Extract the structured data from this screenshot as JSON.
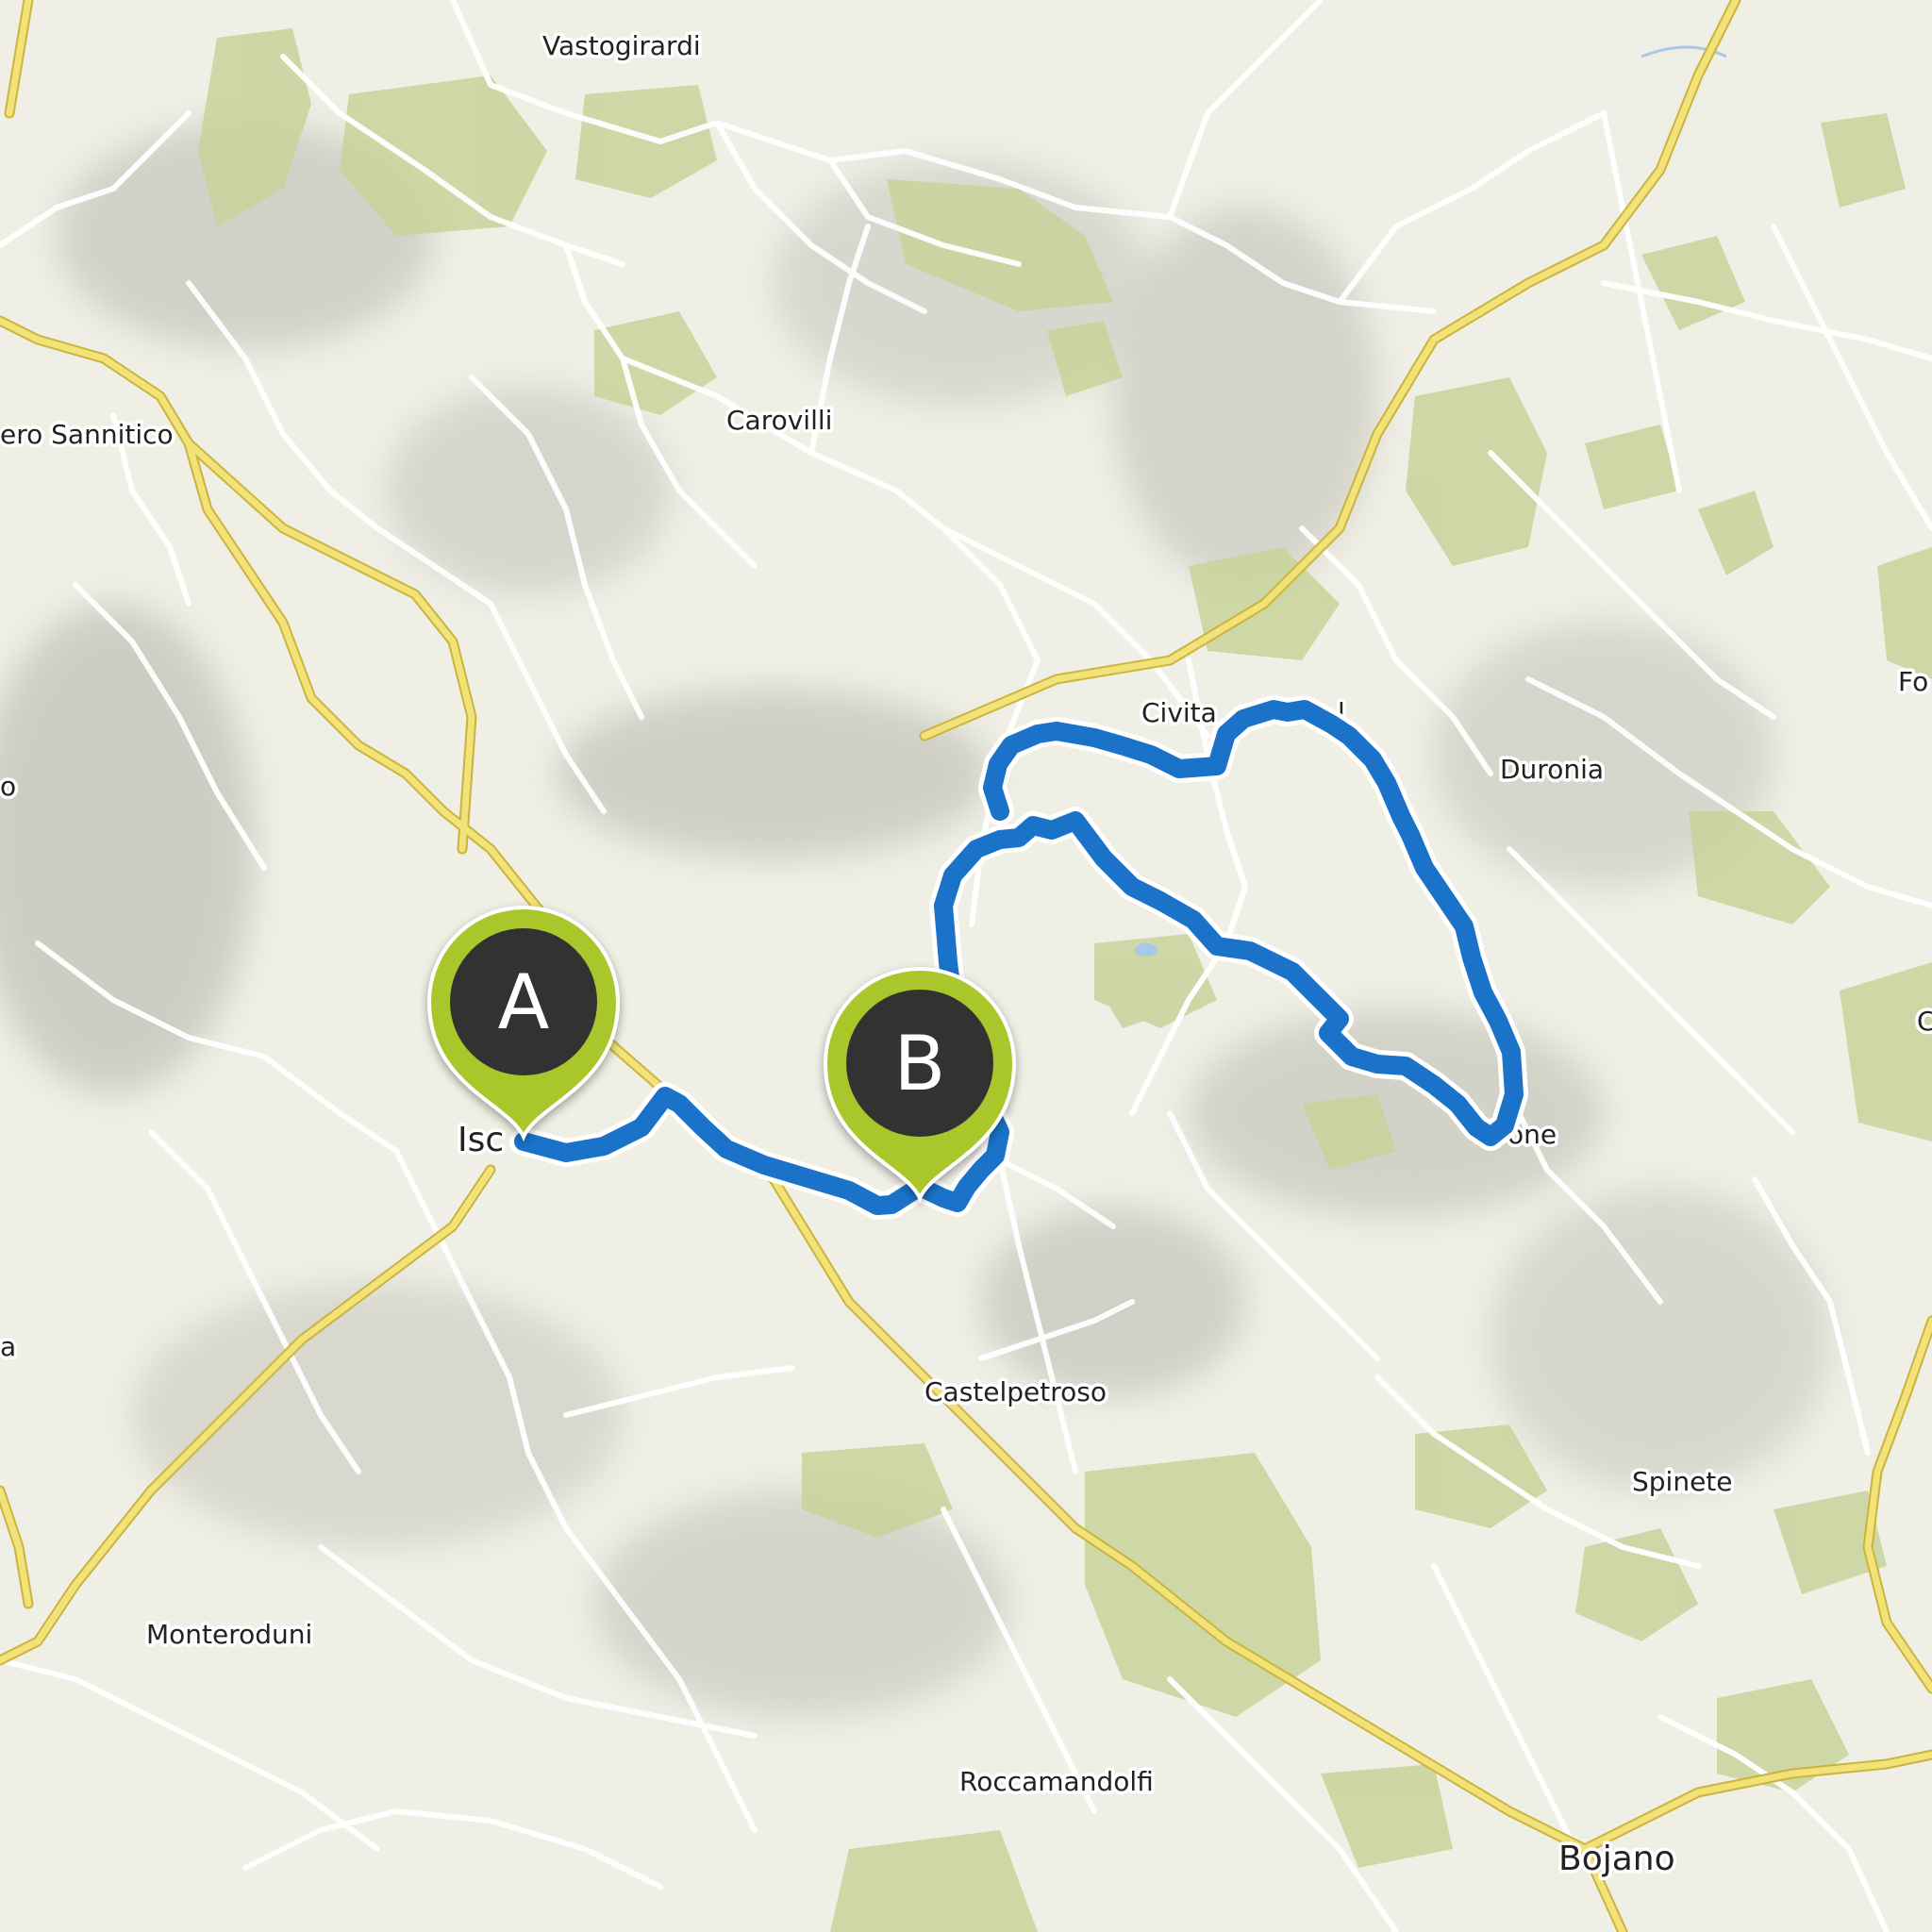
{
  "map": {
    "kind": "topographic route map",
    "route_color": "#1a73c9",
    "road_primary_color": "#f3e27a",
    "road_secondary_color": "#ffffff",
    "forest_color": "#c8d39a",
    "terrain_color": "#efefe6",
    "labels": {
      "vastogirardi": "Vastogirardi",
      "pietrabbondante_partial": "ero Sannitico",
      "carovilli": "Carovilli",
      "civitanova_partial": "Civita",
      "civitanova_tail": "l",
      "duronia": "Duronia",
      "frosolone_partial": "one",
      "isernia_partial": "Isc",
      "castelpetroso": "Castelpetroso",
      "spinete": "Spinete",
      "monteroduni": "Monteroduni",
      "roccamandolfi": "Roccamandolfi",
      "bojano": "Bojano",
      "edge_fo": "Fo",
      "edge_o": "o",
      "edge_a": "a",
      "edge_c": "C"
    },
    "markers": {
      "start": {
        "letter": "A",
        "name": "start-marker"
      },
      "end": {
        "letter": "B",
        "name": "end-marker"
      },
      "marker_color": "#a9c62a",
      "marker_inner_color": "#333333"
    }
  }
}
